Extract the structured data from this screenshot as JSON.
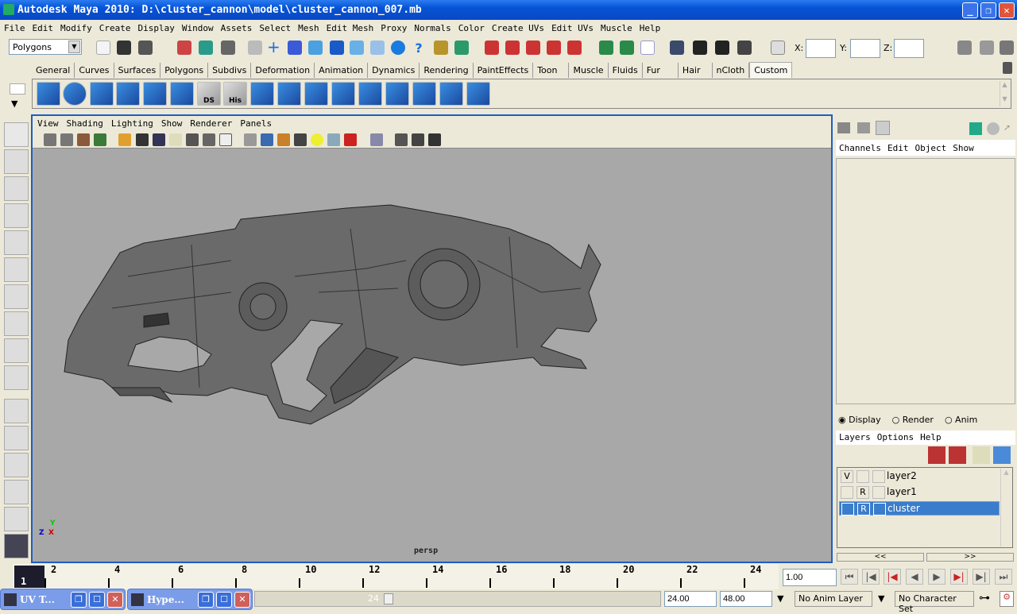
{
  "window": {
    "title": "Autodesk Maya 2010: D:\\cluster_cannon\\model\\cluster_cannon_007.mb",
    "minimize": "_",
    "maximize": "❐",
    "close": "✕"
  },
  "menubar": [
    "File",
    "Edit",
    "Modify",
    "Create",
    "Display",
    "Window",
    "Assets",
    "Select",
    "Mesh",
    "Edit Mesh",
    "Proxy",
    "Normals",
    "Color",
    "Create UVs",
    "Edit UVs",
    "Muscle",
    "Help"
  ],
  "status_line": {
    "menu_set": "Polygons",
    "x_label": "X:",
    "y_label": "Y:",
    "z_label": "Z:",
    "x_value": "",
    "y_value": "",
    "z_value": ""
  },
  "shelf": {
    "tabs": [
      "General",
      "Curves",
      "Surfaces",
      "Polygons",
      "Subdivs",
      "Deformation",
      "Animation",
      "Dynamics",
      "Rendering",
      "PaintEffects",
      "Toon",
      "Muscle",
      "Fluids",
      "Fur",
      "Hair",
      "nCloth",
      "Custom"
    ],
    "active_tab": "Custom",
    "icon_labels": {
      "ds": "DS",
      "his": "His"
    }
  },
  "viewport": {
    "menu": [
      "View",
      "Shading",
      "Lighting",
      "Show",
      "Renderer",
      "Panels"
    ],
    "camera": "persp",
    "axis": {
      "x": "X",
      "y": "Y",
      "z": "Z"
    }
  },
  "channel_box": {
    "menu": [
      "Channels",
      "Edit",
      "Object",
      "Show"
    ]
  },
  "layer_editor": {
    "modes": [
      "Display",
      "Render",
      "Anim"
    ],
    "selected_mode": "Display",
    "menu": [
      "Layers",
      "Options",
      "Help"
    ],
    "layers": [
      {
        "name": "layer2",
        "visible": "V",
        "render": "",
        "selected": false
      },
      {
        "name": "layer1",
        "visible": "",
        "render": "R",
        "selected": false
      },
      {
        "name": "cluster",
        "visible": "",
        "render": "R",
        "selected": true
      }
    ],
    "prev": "<<",
    "next": ">>"
  },
  "time_slider": {
    "current_frame": "1",
    "ticks": [
      "2",
      "4",
      "6",
      "8",
      "10",
      "12",
      "14",
      "16",
      "18",
      "20",
      "22",
      "24"
    ],
    "current_time": "1.00"
  },
  "range_slider": {
    "range_end_label": "24",
    "end_time": "24.00",
    "playback_end": "48.00",
    "anim_layer": "No Anim Layer",
    "character_set": "No Character Set"
  },
  "taskbar": [
    {
      "label": "UV T..."
    },
    {
      "label": "Hype..."
    }
  ],
  "colors": {
    "viewport_bg": "#a8a8a8",
    "active_border": "#1e5dc4",
    "selection": "#3a7dcc",
    "title_bar": "#0553d6"
  }
}
